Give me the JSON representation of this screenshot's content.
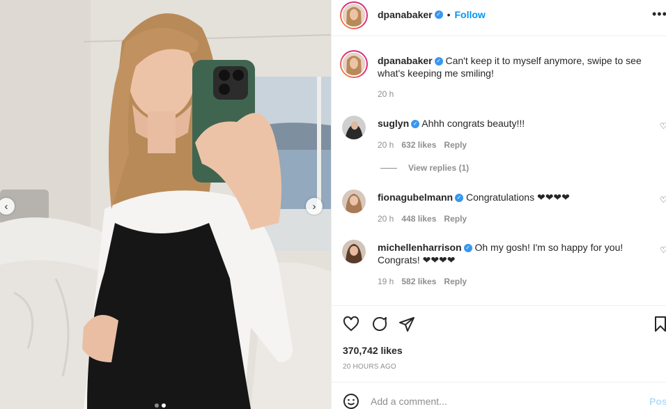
{
  "header": {
    "username": "dpanabaker",
    "separator": "•",
    "follow_label": "Follow",
    "more_icon": "more-icon"
  },
  "caption": {
    "username": "dpanabaker",
    "text": "Can't keep it to myself anymore, swipe to see what's keeping me smiling!",
    "time": "20 h"
  },
  "comments": [
    {
      "username": "suglyn",
      "text": "Ahhh congrats beauty!!!",
      "time": "20 h",
      "likes": "632 likes",
      "reply": "Reply"
    },
    {
      "username": "fionagubelmann",
      "text": "Congratulations ❤❤❤❤",
      "time": "20 h",
      "likes": "448 likes",
      "reply": "Reply"
    },
    {
      "username": "michellenharrison",
      "text": "Oh my gosh! I'm so happy for you! Congrats! ❤❤❤❤",
      "time": "19 h",
      "likes": "582 likes",
      "reply": "Reply"
    }
  ],
  "view_replies": "View replies (1)",
  "likes_count": "370,742 likes",
  "posted_ago": "20 HOURS AGO",
  "add_comment": {
    "placeholder": "Add a comment...",
    "post_label": "Post"
  },
  "media": {
    "nav_prev": "‹",
    "nav_next": "›",
    "slide_count": 2,
    "active_slide": 2
  },
  "colors": {
    "accent": "#0095f6",
    "verified": "#3897f0",
    "muted": "#8e8e8e",
    "divider": "#efefef"
  }
}
